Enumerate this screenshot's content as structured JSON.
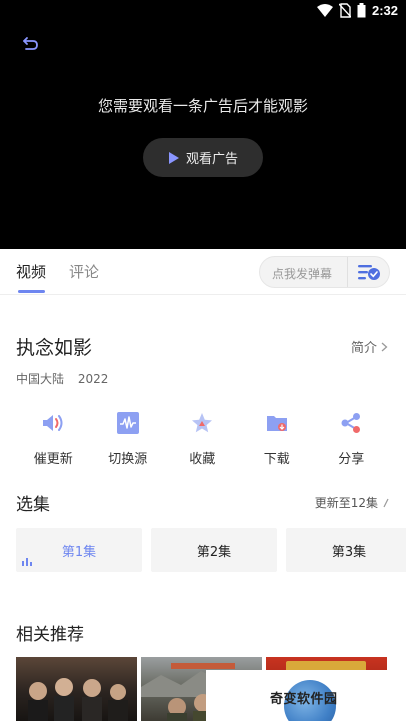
{
  "status_bar": {
    "time": "2:32",
    "icons": [
      "wifi-icon",
      "no-sim-icon",
      "battery-icon"
    ]
  },
  "player": {
    "ad_message": "您需要观看一条广告后才能观影",
    "ad_button_label": "观看广告"
  },
  "tabs": [
    {
      "label": "视频",
      "active": true
    },
    {
      "label": "评论",
      "active": false
    }
  ],
  "danmu": {
    "placeholder": "点我发弹幕"
  },
  "video": {
    "title": "执念如影",
    "intro_link": "简介",
    "region": "中国大陆",
    "year": "2022"
  },
  "actions": [
    {
      "label": "催更新",
      "icon": "speaker-icon"
    },
    {
      "label": "切换源",
      "icon": "waveform-icon"
    },
    {
      "label": "收藏",
      "icon": "star-icon"
    },
    {
      "label": "下载",
      "icon": "download-folder-icon"
    },
    {
      "label": "分享",
      "icon": "share-icon"
    }
  ],
  "episodes": {
    "section_title": "选集",
    "update_info": "更新至12集",
    "items": [
      {
        "label": "第1集",
        "active": true
      },
      {
        "label": "第2集",
        "active": false
      },
      {
        "label": "第3集",
        "active": false
      }
    ]
  },
  "recommend": {
    "section_title": "相关推荐"
  },
  "watermark": {
    "text": "奇变软件园"
  },
  "colors": {
    "accent": "#6e86f0",
    "player_bg": "#000000",
    "icon_red": "#f06a6a"
  }
}
